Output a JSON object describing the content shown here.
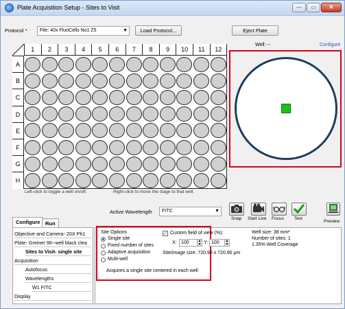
{
  "window": {
    "title": "Plate Acquisition Setup - Sites to Visit",
    "min_glyph": "—",
    "max_glyph": "▭",
    "close_glyph": "✕"
  },
  "header": {
    "protocol_label": "Protocol *",
    "protocol_value": "File: 40x FluoCells No1 Z5",
    "load_protocol": "Load Protocol...",
    "eject_plate": "Eject Plate",
    "well_label": "Well: --",
    "configure_link": "Configure"
  },
  "plate": {
    "columns": [
      "1",
      "2",
      "3",
      "4",
      "5",
      "6",
      "7",
      "8",
      "9",
      "10",
      "11",
      "12"
    ],
    "rows": [
      "A",
      "B",
      "C",
      "D",
      "E",
      "F",
      "G",
      "H"
    ],
    "hint_left": "Left-click to toggle a well on/off.",
    "hint_right": "Right-click to move the stage to that well."
  },
  "acquisition": {
    "active_wavelength_label": "Active Wavelength",
    "active_wavelength_value": "FITC",
    "tools": [
      {
        "label": "Snap",
        "icon": "camera-icon"
      },
      {
        "label": "Start Live",
        "icon": "video-camera-icon"
      },
      {
        "label": "Focus",
        "icon": "glasses-icon"
      },
      {
        "label": "Test",
        "icon": "checkmark-icon"
      }
    ],
    "preview_label": "Preview"
  },
  "tabs": [
    {
      "label": "Configure",
      "active": true
    },
    {
      "label": "Run",
      "active": false
    }
  ],
  "nav": [
    "Objective and Camera- 20X Ph1",
    "Plate- Greiner 96--well black clea",
    "Sites to Visit- single site",
    "Acquisition",
    "Autofocus",
    "Wavelengths",
    "W1 FITC",
    "Display"
  ],
  "site_options": {
    "title": "Site Options",
    "options": [
      "Single site",
      "Fixed number of sites",
      "Adaptive acquisition",
      "Multi-well"
    ],
    "selected": "Single site",
    "description": "Acquires a single site centered in each well"
  },
  "field_of_view": {
    "checkbox_label": "Custom field of view (%):",
    "checked": true,
    "x_label": "X:",
    "x_value": "100",
    "y_label": "Y:",
    "y_value": "100",
    "image_size": "Site/image size: 720.90 x 720.90  µm"
  },
  "well_info": {
    "well_size": "Well size: 38 mm²",
    "num_sites": "Number of sites: 1",
    "coverage": "1.35% Well Coverage"
  },
  "colors": {
    "highlight": "#d9001b",
    "site_green": "#19c219",
    "well_outline": "#1d3d5a"
  }
}
